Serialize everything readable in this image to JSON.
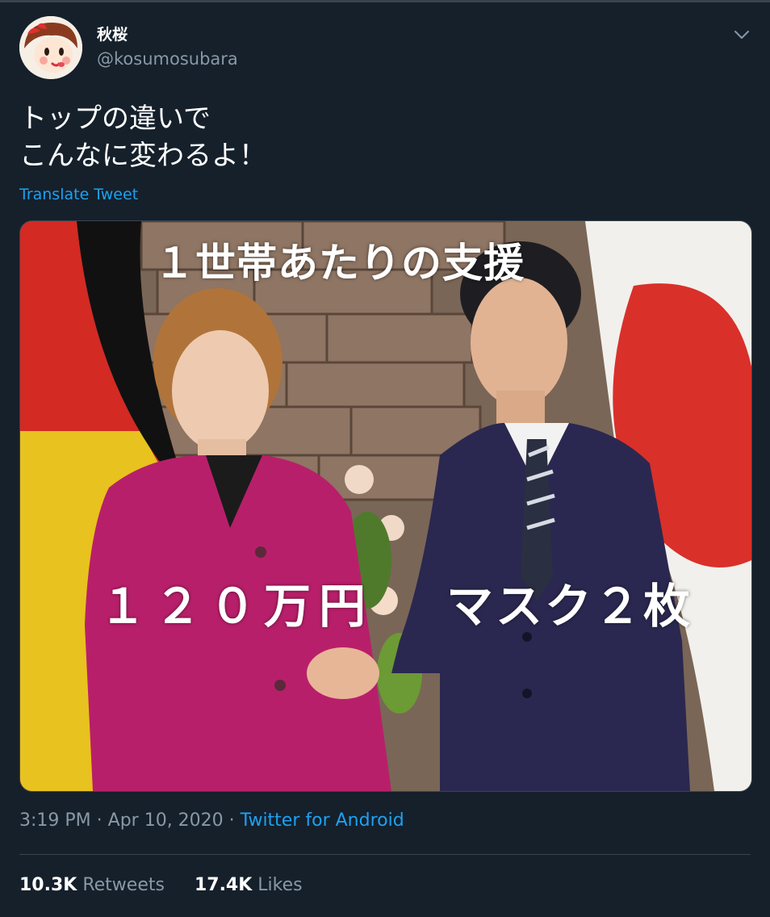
{
  "user": {
    "display_name": "秋桜",
    "handle": "@kosumosubara",
    "avatar_icon": "peko-avatar-icon"
  },
  "tweet": {
    "text": "トップの違いで\nこんなに変わるよ！",
    "translate_label": "Translate Tweet"
  },
  "media": {
    "caption_top": "１世帯あたりの支援",
    "caption_left": "１２０万円",
    "caption_right": "マスク２枚"
  },
  "meta": {
    "time": "3:19 PM",
    "separator": " · ",
    "date": "Apr 10, 2020",
    "source": "Twitter for Android"
  },
  "stats": {
    "retweets_count": "10.3K",
    "retweets_label": "Retweets",
    "likes_count": "17.4K",
    "likes_label": "Likes"
  },
  "colors": {
    "background": "#15202b",
    "link": "#1da1f2",
    "secondary_text": "#8899a6",
    "divider": "#38444d"
  }
}
